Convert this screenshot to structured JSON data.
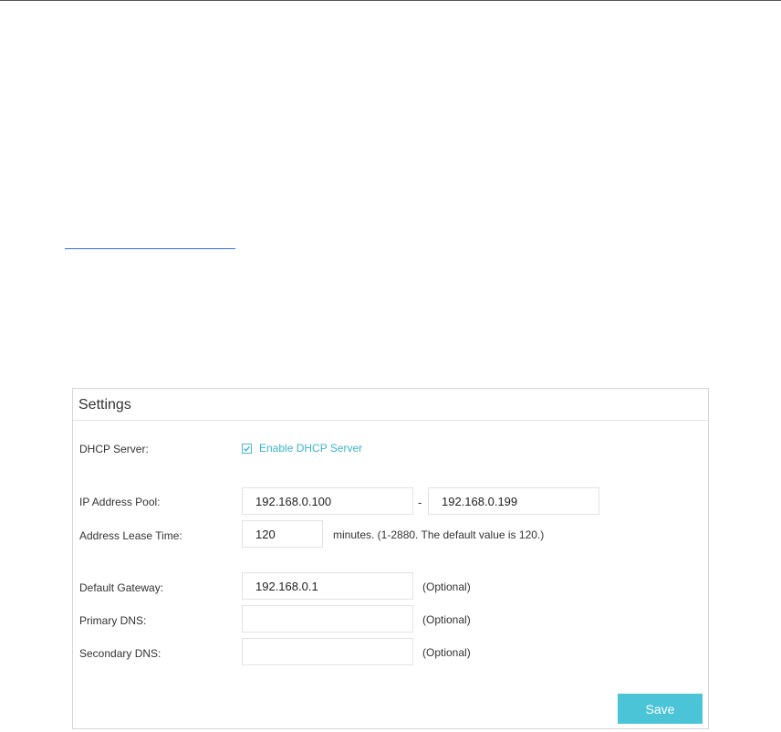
{
  "panel": {
    "title": "Settings"
  },
  "dhcp_server": {
    "label": "DHCP Server:",
    "checkbox_label": "Enable DHCP Server",
    "checked": true
  },
  "ip_pool": {
    "label": "IP Address Pool:",
    "start": "192.168.0.100",
    "separator": "-",
    "end": "192.168.0.199"
  },
  "lease_time": {
    "label": "Address Lease Time:",
    "value": "120",
    "hint": "minutes. (1-2880. The default value is 120.)"
  },
  "default_gateway": {
    "label": "Default Gateway:",
    "value": "192.168.0.1",
    "hint": "(Optional)"
  },
  "primary_dns": {
    "label": "Primary DNS:",
    "value": "",
    "hint": "(Optional)"
  },
  "secondary_dns": {
    "label": "Secondary DNS:",
    "value": "",
    "hint": "(Optional)"
  },
  "actions": {
    "save_label": "Save"
  },
  "colors": {
    "accent": "#4cc4d8",
    "checkbox": "#3ab4cb",
    "border": "#d6d6d6"
  },
  "icons": {
    "checkbox": "checkbox-checked-icon"
  }
}
